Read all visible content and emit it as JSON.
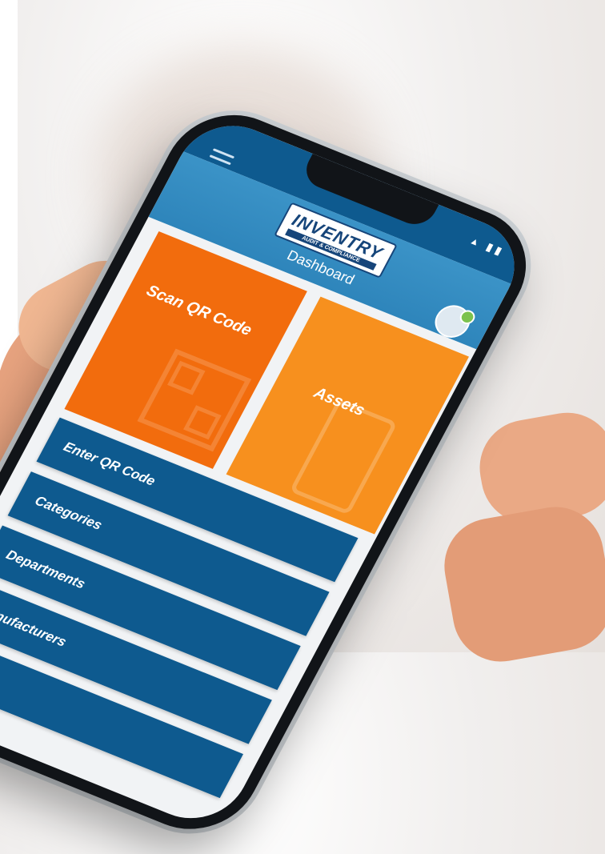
{
  "app": {
    "logo_text": "INVENTRY",
    "logo_subtext": "AUDIT & COMPLIANCE"
  },
  "header": {
    "title": "Dashboard"
  },
  "tiles": [
    {
      "label": "Scan QR Code",
      "icon": "qr-code-icon",
      "color": "#f26c0d"
    },
    {
      "label": "Assets",
      "icon": "smartphone-icon",
      "color": "#f7901e"
    }
  ],
  "menu": [
    {
      "label": "Enter QR Code"
    },
    {
      "label": "Categories"
    },
    {
      "label": "Departments"
    },
    {
      "label": "Manufacturers"
    },
    {
      "label": ""
    }
  ],
  "colors": {
    "primary_blue": "#0e5a8f",
    "header_blue": "#3b93c7",
    "scan_orange": "#f26c0d",
    "assets_orange": "#f7901e"
  }
}
